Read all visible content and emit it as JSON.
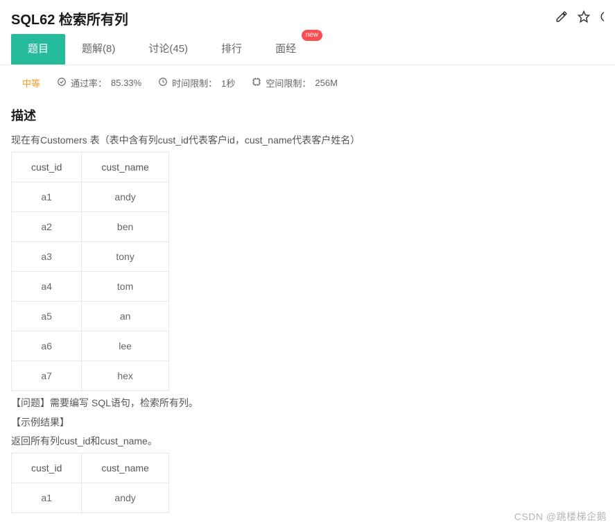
{
  "header": {
    "title": "SQL62 检索所有列"
  },
  "tabs": {
    "items": [
      {
        "label": "题目",
        "active": true
      },
      {
        "label": "题解(8)"
      },
      {
        "label": "讨论(45)"
      },
      {
        "label": "排行"
      },
      {
        "label": "面经",
        "badge": "new"
      }
    ]
  },
  "meta": {
    "difficulty": "中等",
    "pass_label": "通过率：",
    "pass_value": "85.33%",
    "time_label": "时间限制：",
    "time_value": "1秒",
    "space_label": "空间限制：",
    "space_value": "256M"
  },
  "content": {
    "desc_heading": "描述",
    "intro": "现在有Customers 表（表中含有列cust_id代表客户id，cust_name代表客户姓名）",
    "table1": {
      "headers": [
        "cust_id",
        "cust_name"
      ],
      "rows": [
        [
          "a1",
          "andy"
        ],
        [
          "a2",
          "ben"
        ],
        [
          "a3",
          "tony"
        ],
        [
          "a4",
          "tom"
        ],
        [
          "a5",
          "an"
        ],
        [
          "a6",
          "lee"
        ],
        [
          "a7",
          "hex"
        ]
      ]
    },
    "question_line": "【问题】需要编写 SQL语句，检索所有列。",
    "example_heading": "【示例结果】",
    "example_return": "返回所有列cust_id和cust_name。",
    "table2": {
      "headers": [
        "cust_id",
        "cust_name"
      ],
      "rows": [
        [
          "a1",
          "andy"
        ]
      ]
    }
  },
  "watermark": "CSDN @跳楼梯企鹅"
}
